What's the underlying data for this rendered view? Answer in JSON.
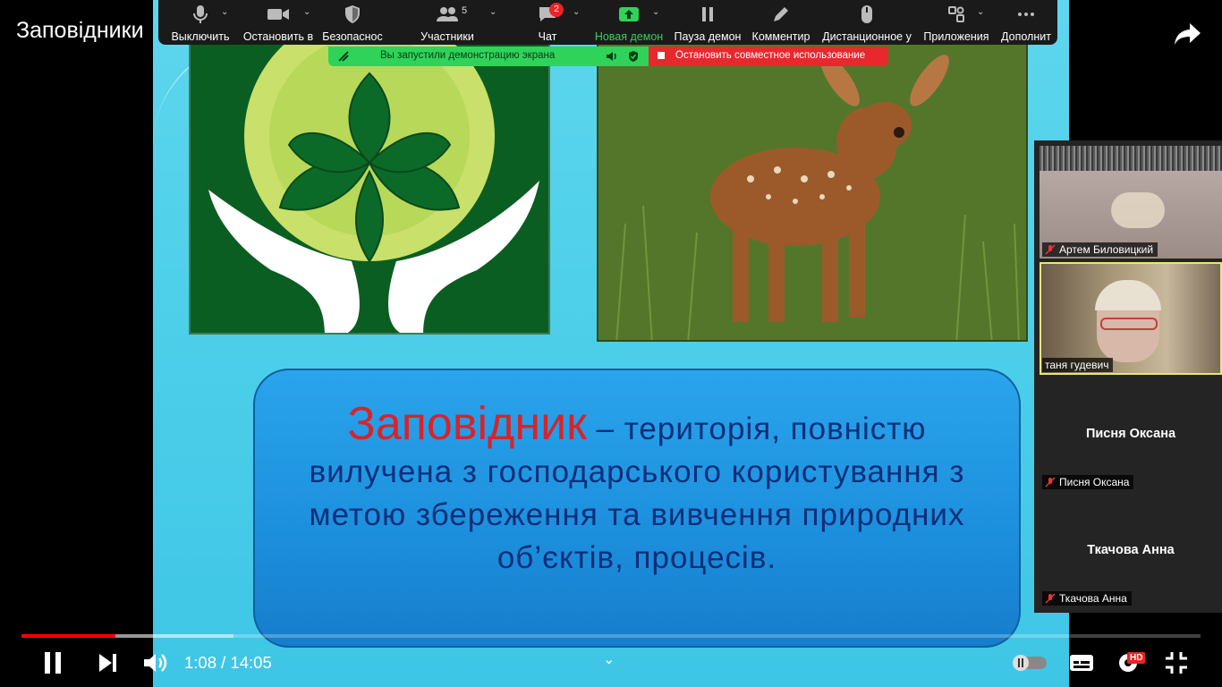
{
  "video": {
    "title": "Заповідники",
    "current_time": "1:08",
    "duration": "14:05",
    "time_separator": " / ",
    "played_fraction": 0.08,
    "buffered_fraction": 0.18
  },
  "zoom_toolbar": {
    "items": [
      {
        "label": "Выключить",
        "icon": "microphone-icon"
      },
      {
        "label": "Остановить в",
        "icon": "video-camera-icon"
      },
      {
        "label": "Безопаснос",
        "icon": "shield-icon"
      },
      {
        "label": "Участники",
        "icon": "participants-icon"
      },
      {
        "label": "Чат",
        "icon": "chat-icon"
      },
      {
        "label": "Новая демон",
        "icon": "share-screen-icon"
      },
      {
        "label": "Пауза демон",
        "icon": "pause-icon"
      },
      {
        "label": "Комментир",
        "icon": "pencil-icon"
      },
      {
        "label": "Дистанционное у",
        "icon": "mouse-icon"
      },
      {
        "label": "Приложения",
        "icon": "apps-icon"
      },
      {
        "label": "Дополнит",
        "icon": "more-icon"
      }
    ],
    "participants_count": "5",
    "chat_badge": "2"
  },
  "share_status": {
    "message": "Вы запустили демонстрацию экрана",
    "stop_label": "Остановить совместное использование"
  },
  "slide": {
    "term": "Заповідник",
    "definition": " – територія, повністю вилучена з господарського користування з метою збереження та вивчення природних об’єктів, процесів."
  },
  "gallery": {
    "tiles": [
      {
        "name": "Артем Биловицкий"
      },
      {
        "name": "таня гудевич"
      },
      {
        "name": "Писня Оксана",
        "big_name": "Писня Оксана"
      },
      {
        "name": "Ткачова Анна",
        "big_name": "Ткачова Анна"
      }
    ]
  },
  "player": {
    "hd_badge": "HD"
  },
  "colors": {
    "progress": "#ff0000",
    "share_green": "#2fd35a",
    "stop_red": "#e8282d",
    "term_red": "#d7242a",
    "definition_navy": "#0b2e7a"
  }
}
